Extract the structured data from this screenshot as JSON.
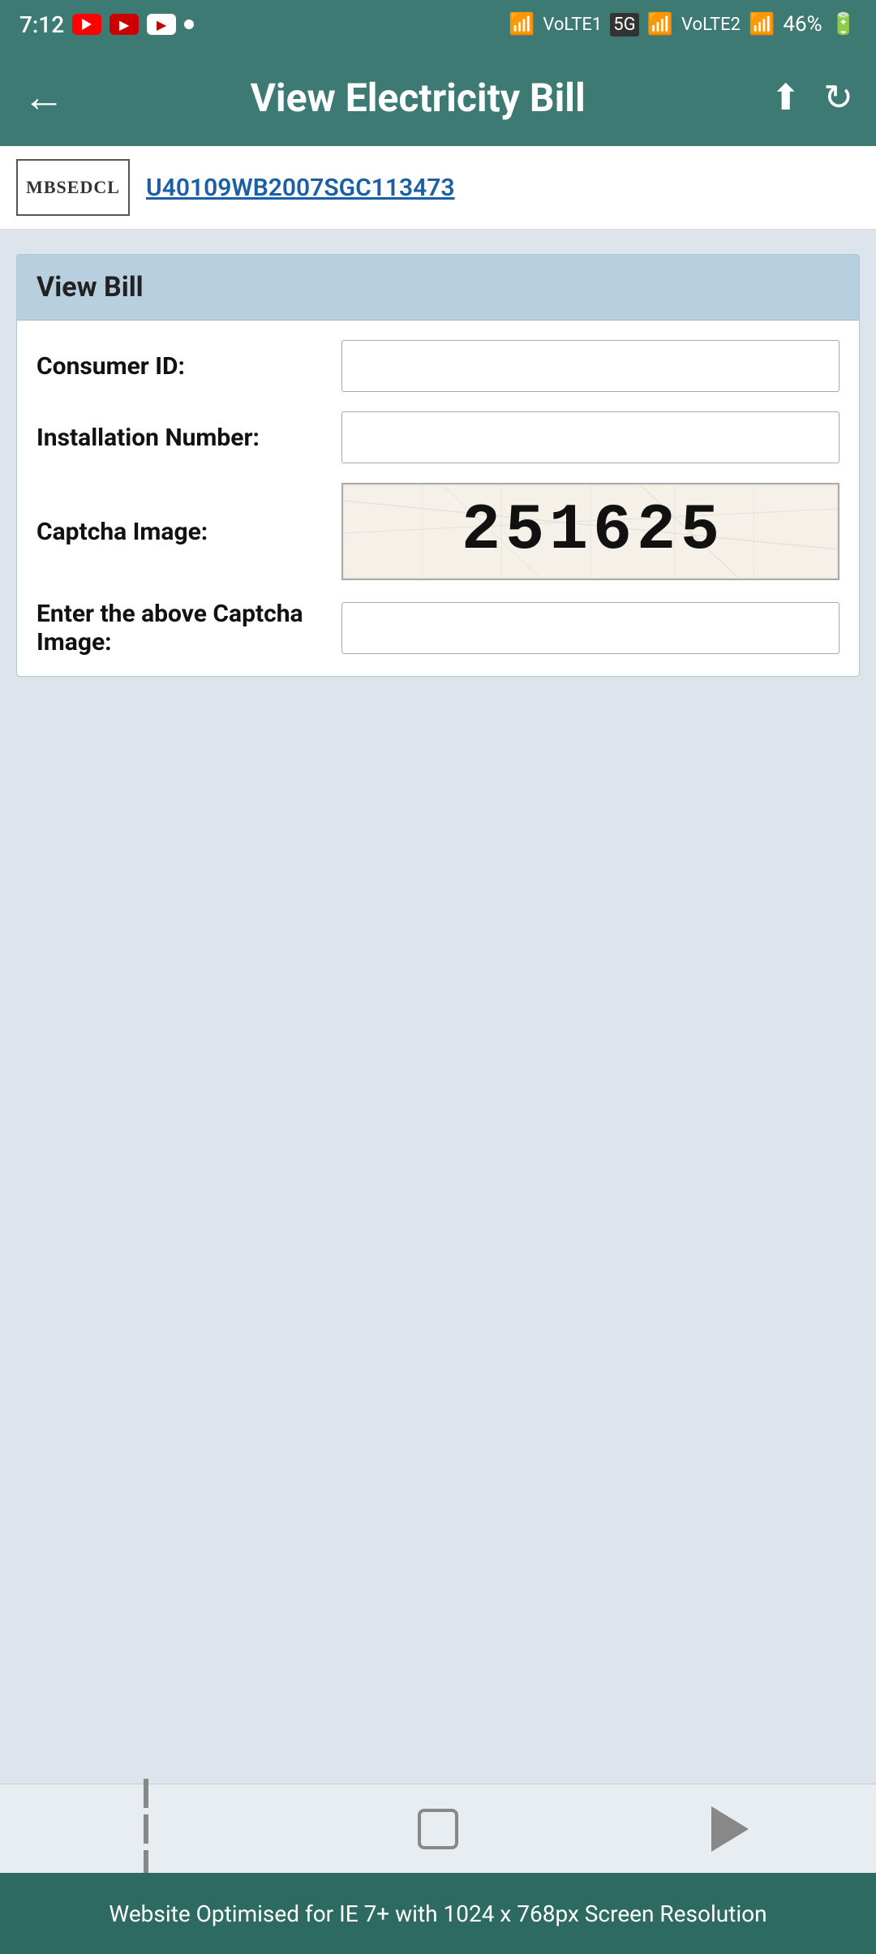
{
  "statusBar": {
    "time": "7:12",
    "battery": "46%"
  },
  "appBar": {
    "title": "View Electricity Bill",
    "backIcon": "←",
    "shareIcon": "⬆",
    "refreshIcon": "↻"
  },
  "logoRow": {
    "logoText": "MBSEDCL",
    "companyId": "U40109WB2007SGC113473"
  },
  "billCard": {
    "headerLabel": "View Bill",
    "form": {
      "consumerIdLabel": "Consumer ID:",
      "consumerIdValue": "",
      "installationNumberLabel": "Installation Number:",
      "installationNumberValue": "",
      "captchaImageLabel": "Captcha Image:",
      "captchaDigits": [
        "2",
        "5",
        "1",
        "6",
        "2",
        "5"
      ],
      "captchaEntryLabel": "Enter the above Captcha Image:",
      "captchaEntryValue": ""
    }
  },
  "footer": {
    "text": "Website Optimised for IE 7+ with 1024 x 768px Screen Resolution"
  },
  "navBar": {
    "backItem": "back",
    "homeItem": "home",
    "forwardItem": "forward"
  }
}
